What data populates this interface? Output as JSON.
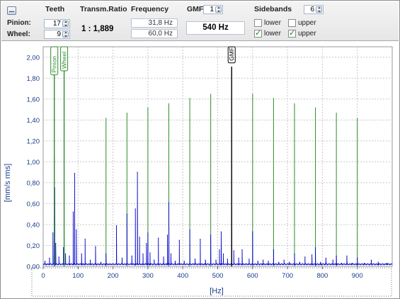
{
  "header": {
    "teeth": "Teeth",
    "ratio": "Transm.Ratio",
    "frequency": "Frequency",
    "gmf": "GMF",
    "gmf_value": "1",
    "sidebands": "Sidebands",
    "sidebands_value": "6"
  },
  "pinion": {
    "label": "Pinion:",
    "teeth": "17",
    "frequency": "31,8 Hz"
  },
  "wheel": {
    "label": "Wheel:",
    "teeth": "9",
    "frequency": "60,0 Hz"
  },
  "ratio_value": "1 : 1,889",
  "gmf_frequency": "540 Hz",
  "sideband_checks": {
    "row1": {
      "lower_label": "lower",
      "lower_checked": false,
      "upper_label": "upper",
      "upper_checked": false
    },
    "row2": {
      "lower_label": "lower",
      "lower_checked": true,
      "upper_label": "upper",
      "upper_checked": true
    }
  },
  "colors": {
    "spectrum": "#0000cc",
    "marker": "#2e8b2e",
    "gmf_marker": "#000000",
    "grid": "#c8c8c8"
  },
  "chart_data": {
    "type": "line",
    "xlabel": "[Hz]",
    "ylabel": "[mm/s rms]",
    "xlim": [
      0,
      1000
    ],
    "ylim": [
      0,
      2.1
    ],
    "x_ticks": [
      "0",
      "100",
      "200",
      "300",
      "400",
      "500",
      "600",
      "700",
      "800",
      "900"
    ],
    "x_tick_values": [
      0,
      100,
      200,
      300,
      400,
      500,
      600,
      700,
      800,
      900
    ],
    "y_ticks": [
      "0,00",
      "0,20",
      "0,40",
      "0,60",
      "0,80",
      "1,00",
      "1,20",
      "1,40",
      "1,60",
      "1,80",
      "2,00"
    ],
    "y_tick_values": [
      0,
      0.2,
      0.4,
      0.6,
      0.8,
      1.0,
      1.2,
      1.4,
      1.6,
      1.8,
      2.0
    ],
    "grid": true,
    "markers": [
      {
        "x": 31.8,
        "label": "Pinion",
        "kind": "pinion"
      },
      {
        "x": 60.0,
        "label": "Wheel",
        "kind": "wheel"
      },
      {
        "x": 540,
        "label": "GMF",
        "kind": "gmf"
      }
    ],
    "sideband_lines": [
      {
        "x": 180,
        "y": 1.42
      },
      {
        "x": 240,
        "y": 1.47
      },
      {
        "x": 300,
        "y": 1.52
      },
      {
        "x": 360,
        "y": 1.56
      },
      {
        "x": 420,
        "y": 1.61
      },
      {
        "x": 480,
        "y": 1.65
      },
      {
        "x": 600,
        "y": 1.65
      },
      {
        "x": 660,
        "y": 1.61
      },
      {
        "x": 720,
        "y": 1.56
      },
      {
        "x": 780,
        "y": 1.52
      },
      {
        "x": 840,
        "y": 1.47
      },
      {
        "x": 900,
        "y": 1.42
      }
    ],
    "peaks": [
      {
        "x": 5,
        "y": 0.05
      },
      {
        "x": 18,
        "y": 0.08
      },
      {
        "x": 28,
        "y": 0.32
      },
      {
        "x": 31.8,
        "y": 1.05
      },
      {
        "x": 33,
        "y": 0.75
      },
      {
        "x": 36,
        "y": 0.22
      },
      {
        "x": 45,
        "y": 0.09
      },
      {
        "x": 58,
        "y": 0.18
      },
      {
        "x": 60,
        "y": 0.26
      },
      {
        "x": 64,
        "y": 0.12
      },
      {
        "x": 75,
        "y": 0.1
      },
      {
        "x": 86,
        "y": 0.52
      },
      {
        "x": 90,
        "y": 0.89
      },
      {
        "x": 95,
        "y": 0.35
      },
      {
        "x": 110,
        "y": 0.12
      },
      {
        "x": 120,
        "y": 0.26
      },
      {
        "x": 135,
        "y": 0.06
      },
      {
        "x": 150,
        "y": 0.19
      },
      {
        "x": 165,
        "y": 0.04
      },
      {
        "x": 180,
        "y": 0.12
      },
      {
        "x": 210,
        "y": 0.39
      },
      {
        "x": 226,
        "y": 0.08
      },
      {
        "x": 240,
        "y": 0.5
      },
      {
        "x": 254,
        "y": 0.1
      },
      {
        "x": 264,
        "y": 0.55
      },
      {
        "x": 270,
        "y": 0.9
      },
      {
        "x": 276,
        "y": 0.28
      },
      {
        "x": 286,
        "y": 0.12
      },
      {
        "x": 296,
        "y": 0.22
      },
      {
        "x": 300,
        "y": 0.32
      },
      {
        "x": 306,
        "y": 0.13
      },
      {
        "x": 318,
        "y": 0.06
      },
      {
        "x": 330,
        "y": 0.27
      },
      {
        "x": 345,
        "y": 0.09
      },
      {
        "x": 356,
        "y": 0.3
      },
      {
        "x": 360,
        "y": 0.61
      },
      {
        "x": 366,
        "y": 0.12
      },
      {
        "x": 378,
        "y": 0.05
      },
      {
        "x": 390,
        "y": 0.25
      },
      {
        "x": 404,
        "y": 0.05
      },
      {
        "x": 420,
        "y": 0.35
      },
      {
        "x": 435,
        "y": 0.07
      },
      {
        "x": 450,
        "y": 0.26
      },
      {
        "x": 465,
        "y": 0.06
      },
      {
        "x": 480,
        "y": 0.3
      },
      {
        "x": 495,
        "y": 0.06
      },
      {
        "x": 505,
        "y": 0.16
      },
      {
        "x": 510,
        "y": 0.33
      },
      {
        "x": 516,
        "y": 0.12
      },
      {
        "x": 528,
        "y": 0.07
      },
      {
        "x": 540,
        "y": 0.56
      },
      {
        "x": 546,
        "y": 0.15
      },
      {
        "x": 560,
        "y": 0.08
      },
      {
        "x": 570,
        "y": 0.16
      },
      {
        "x": 590,
        "y": 0.07
      },
      {
        "x": 600,
        "y": 0.33
      },
      {
        "x": 615,
        "y": 0.05
      },
      {
        "x": 630,
        "y": 0.06
      },
      {
        "x": 645,
        "y": 0.05
      },
      {
        "x": 660,
        "y": 0.16
      },
      {
        "x": 675,
        "y": 0.04
      },
      {
        "x": 690,
        "y": 0.06
      },
      {
        "x": 705,
        "y": 0.04
      },
      {
        "x": 720,
        "y": 0.12
      },
      {
        "x": 735,
        "y": 0.04
      },
      {
        "x": 750,
        "y": 0.09
      },
      {
        "x": 770,
        "y": 0.11
      },
      {
        "x": 780,
        "y": 0.18
      },
      {
        "x": 795,
        "y": 0.04
      },
      {
        "x": 810,
        "y": 0.08
      },
      {
        "x": 830,
        "y": 0.06
      },
      {
        "x": 840,
        "y": 0.1
      },
      {
        "x": 855,
        "y": 0.03
      },
      {
        "x": 870,
        "y": 0.1
      },
      {
        "x": 885,
        "y": 0.03
      },
      {
        "x": 900,
        "y": 0.08
      },
      {
        "x": 920,
        "y": 0.03
      },
      {
        "x": 940,
        "y": 0.06
      },
      {
        "x": 960,
        "y": 0.04
      },
      {
        "x": 985,
        "y": 0.03
      }
    ]
  }
}
